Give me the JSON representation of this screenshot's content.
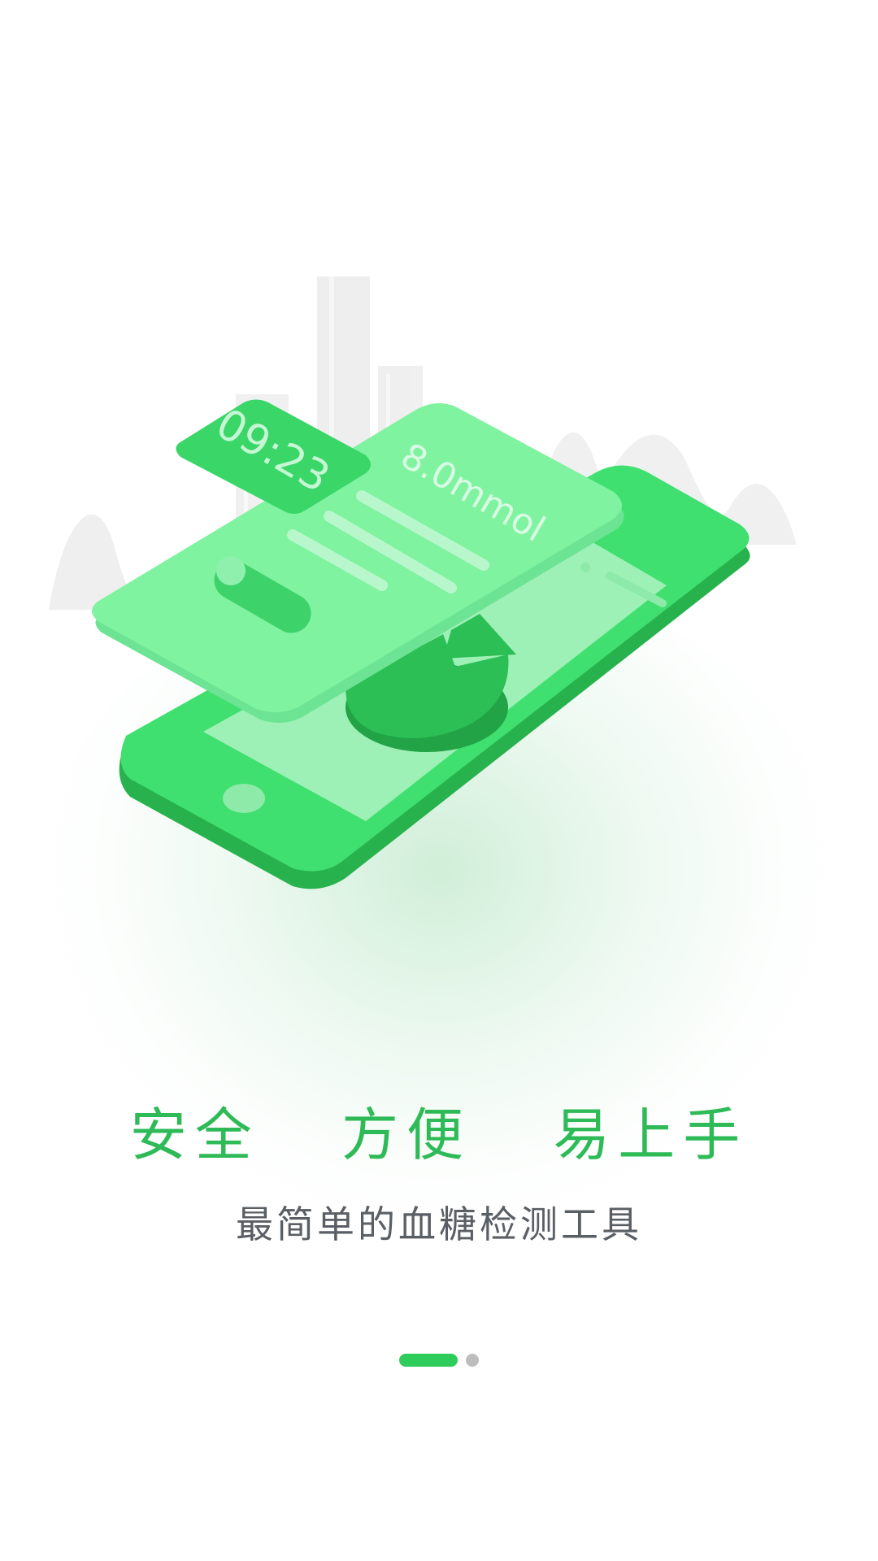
{
  "colors": {
    "accent": "#2ebb57",
    "subtitle": "#5a5f66",
    "dot_active": "#2ecc5a",
    "dot_inactive": "#bdbdbd"
  },
  "illustration": {
    "clock_time": "09:23",
    "reading": "8.0mmol"
  },
  "headline": {
    "items": [
      "安全",
      "方便",
      "易上手"
    ]
  },
  "subtitle": "最简单的血糖检测工具",
  "pager": {
    "total_pages": 2,
    "current_page": 1
  }
}
